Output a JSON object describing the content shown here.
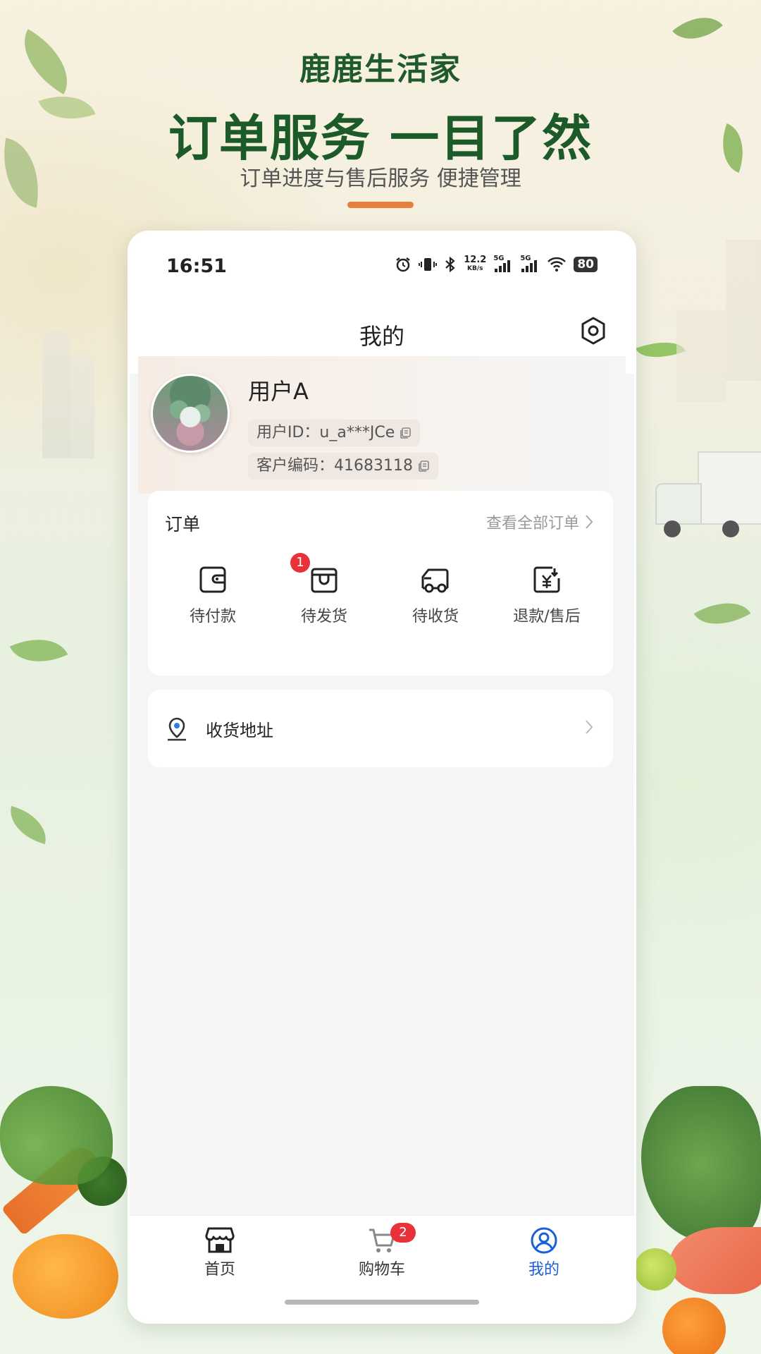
{
  "promo": {
    "brand": "鹿鹿生活家",
    "headline": "订单服务 一目了然",
    "subline": "订单进度与售后服务 便捷管理"
  },
  "statusbar": {
    "time": "16:51",
    "net_speed_value": "12.2",
    "net_speed_unit": "KB/s",
    "sim1": "5G",
    "sim2": "5G",
    "battery": "80",
    "icons": [
      "alarm-icon",
      "vibrate-icon",
      "bluetooth-icon",
      "signal-icon",
      "wifi-icon",
      "battery-icon"
    ]
  },
  "page": {
    "title": "我的"
  },
  "profile": {
    "username": "用户A",
    "user_id": "用户ID：u_a***JCe",
    "customer_code": "客户编码：41683118"
  },
  "orders": {
    "title": "订单",
    "view_all": "查看全部订单",
    "items": [
      {
        "label": "待付款",
        "icon": "wallet-icon",
        "badge": null
      },
      {
        "label": "待发货",
        "icon": "package-icon",
        "badge": "1"
      },
      {
        "label": "待收货",
        "icon": "truck-icon",
        "badge": null
      },
      {
        "label": "退款/售后",
        "icon": "refund-icon",
        "badge": null
      }
    ]
  },
  "address": {
    "label": "收货地址"
  },
  "tabbar": {
    "tabs": [
      {
        "label": "首页",
        "icon": "store-icon",
        "badge": null
      },
      {
        "label": "购物车",
        "icon": "cart-icon",
        "badge": "2"
      },
      {
        "label": "我的",
        "icon": "user-icon",
        "badge": null,
        "active": true
      }
    ]
  },
  "colors": {
    "brand_green": "#1d5a2a",
    "accent_orange": "#e57f3b",
    "active_blue": "#1a5fd6",
    "badge_red": "#e8323a"
  }
}
